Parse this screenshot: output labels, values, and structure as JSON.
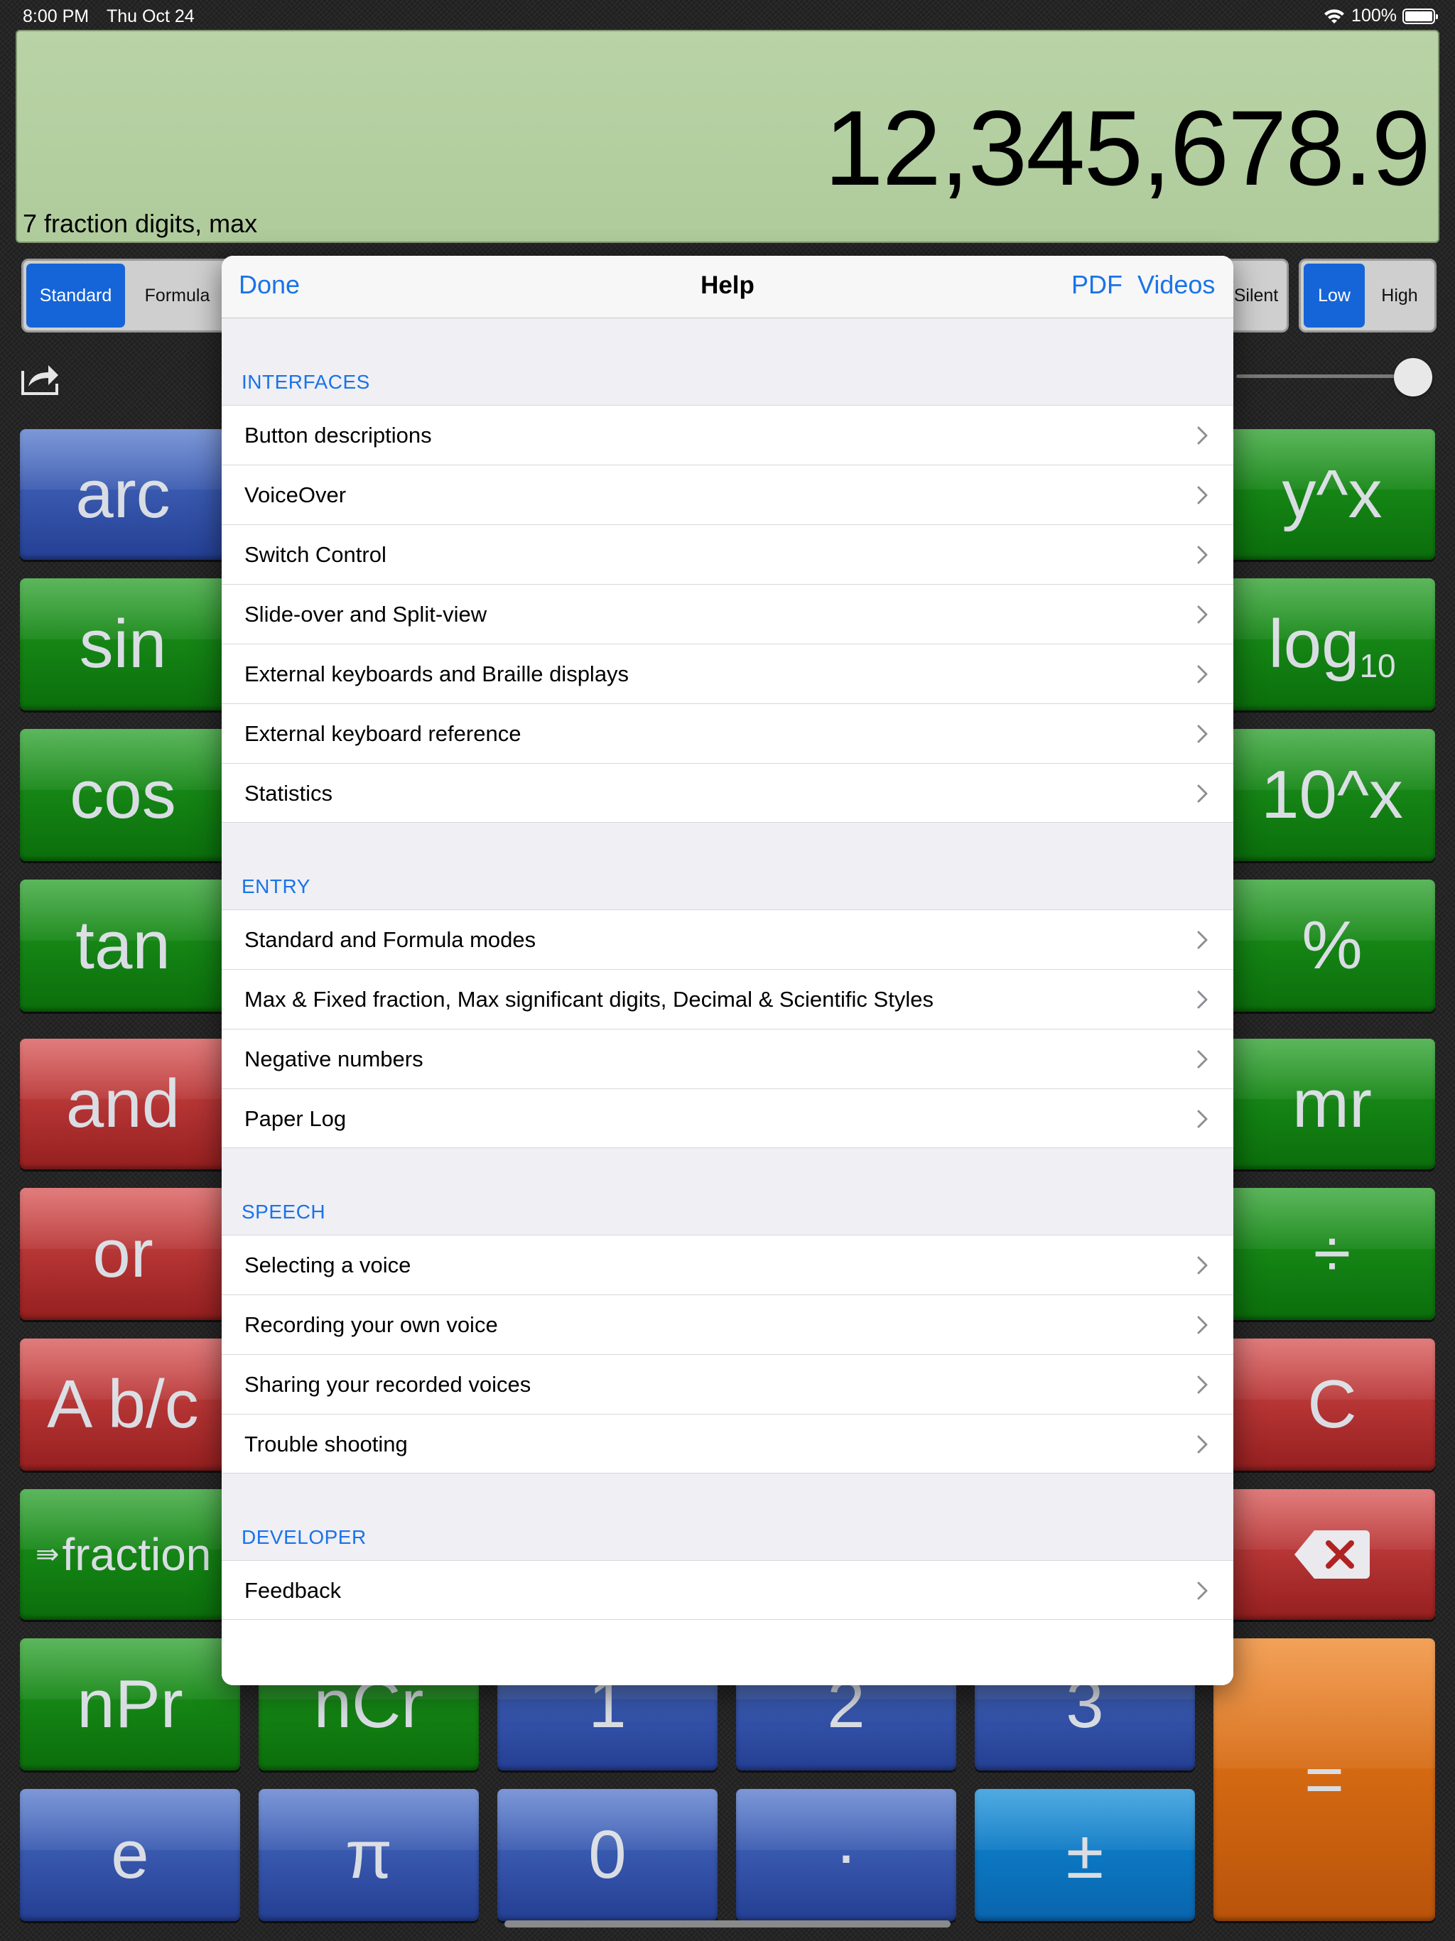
{
  "status_bar": {
    "time": "8:00 PM",
    "date": "Thu Oct 24",
    "battery": "100%"
  },
  "display": {
    "value": "12,345,678.9",
    "subtitle": "7 fraction digits, max"
  },
  "mode_segment": {
    "standard": "Standard",
    "formula": "Formula"
  },
  "speech_segment": {
    "silent": "Silent"
  },
  "pitch_segment": {
    "low": "Low",
    "high": "High"
  },
  "keys": {
    "arc": "arc",
    "sin": "sin",
    "cos": "cos",
    "tan": "tan",
    "and": "and",
    "or": "or",
    "abc": "A b/c",
    "fraction": "fraction",
    "npr": "nPr",
    "ncr": "nCr",
    "one": "1",
    "two": "2",
    "three": "3",
    "e": "e",
    "pi": "π",
    "zero": "0",
    "dot": "·",
    "plusminus": "±",
    "yx": "y^x",
    "log": "log",
    "log_sub": "10",
    "tenx": "10^x",
    "percent": "%",
    "mr": "mr",
    "divide": "÷",
    "clear": "C",
    "equals": "="
  },
  "help": {
    "done": "Done",
    "title": "Help",
    "pdf": "PDF",
    "videos": "Videos",
    "sections": [
      {
        "header": "INTERFACES",
        "items": [
          "Button descriptions",
          "VoiceOver",
          "Switch Control",
          "Slide-over and Split-view",
          "External keyboards and Braille displays",
          "External keyboard reference",
          "Statistics"
        ]
      },
      {
        "header": "ENTRY",
        "items": [
          "Standard and Formula modes",
          "Max & Fixed fraction, Max significant digits, Decimal & Scientific Styles",
          "Negative numbers",
          "Paper Log"
        ]
      },
      {
        "header": "SPEECH",
        "items": [
          "Selecting a voice",
          "Recording your own voice",
          "Sharing your recorded voices",
          "Trouble shooting"
        ]
      },
      {
        "header": "DEVELOPER",
        "items": [
          "Feedback"
        ]
      }
    ]
  },
  "colors": {
    "accent": "#1a73e8",
    "lcd": "#b5cfa1",
    "key_green": "#12801a",
    "key_blue": "#2f52a8",
    "key_red": "#b52f2f",
    "key_orange": "#d96a12"
  },
  "icons": [
    "wifi-icon",
    "battery-icon",
    "share-icon",
    "chevron-right-icon",
    "backspace-icon",
    "fraction-arrow-icon"
  ]
}
